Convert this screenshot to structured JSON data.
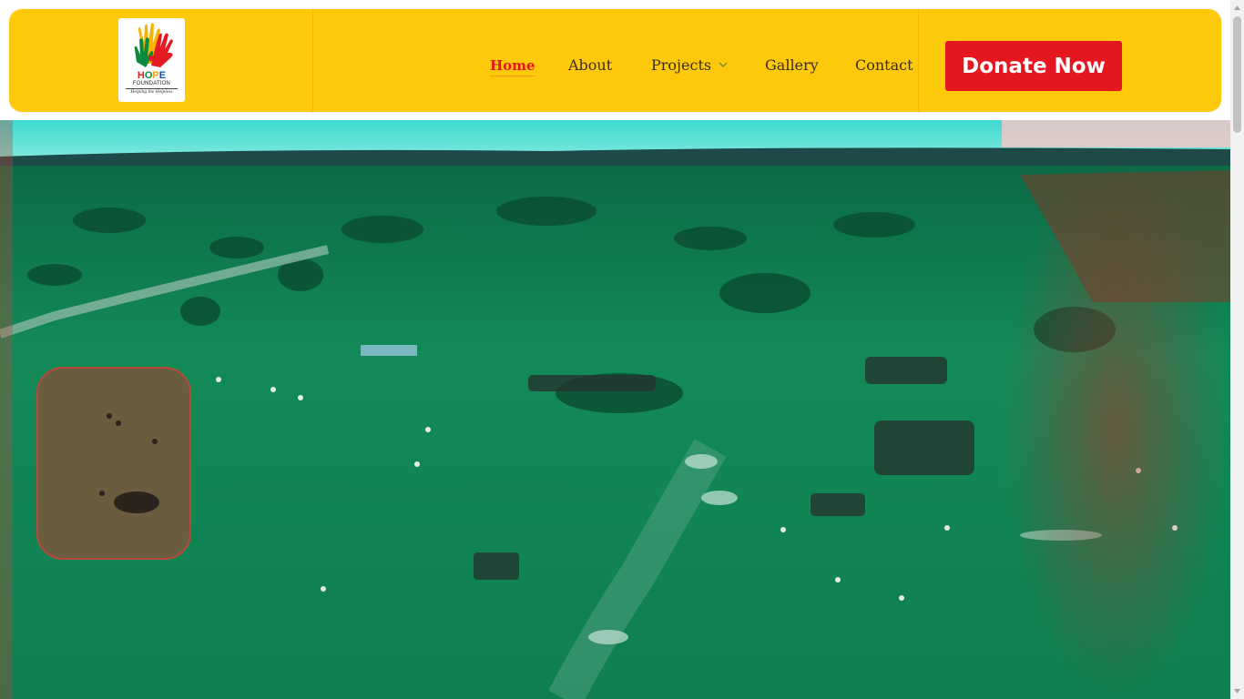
{
  "logo": {
    "letters": [
      "H",
      "O",
      "P",
      "E"
    ],
    "word": "HOPE",
    "subtitle": "FOUNDATION",
    "tagline": "Helping the Helpless",
    "icon": "raised-hands-icon"
  },
  "nav": {
    "items": [
      {
        "label": "Home",
        "active": true
      },
      {
        "label": "About",
        "active": false
      },
      {
        "label": "Projects",
        "active": false,
        "has_dropdown": true,
        "dropdown_icon": "chevron-down-icon"
      },
      {
        "label": "Gallery",
        "active": false
      },
      {
        "label": "Contact",
        "active": false
      }
    ]
  },
  "donate": {
    "label": "Donate Now"
  },
  "colors": {
    "header_bg": "#fec80b",
    "nav_active": "#e8141f",
    "nav_text": "#3a2e12",
    "donate_bg": "#e5161f",
    "hero_tint": "#0f8a55"
  },
  "hero": {
    "image": "aerial-savanna-gathering-photo"
  }
}
